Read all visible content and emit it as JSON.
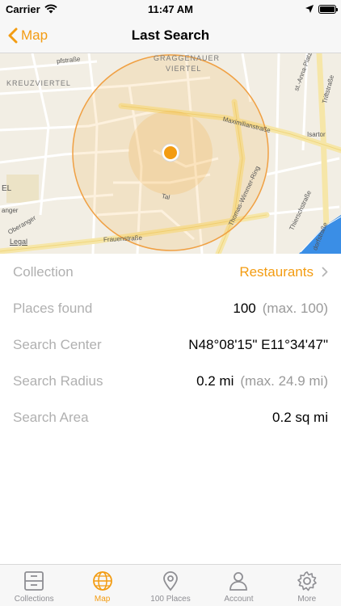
{
  "status_bar": {
    "carrier": "Carrier",
    "time": "11:47 AM"
  },
  "nav": {
    "back_label": "Map",
    "title": "Last Search"
  },
  "map": {
    "district_labels": [
      "GRAGGENAUER",
      "VIERTEL",
      "KREUZVIERTEL"
    ],
    "street_labels": [
      "Maximilianstraße",
      "Thomas-Wimmer-Ring",
      "Frauenstraße",
      "Thierschstraße",
      "Triftstraße",
      "Tal",
      "Oberanger",
      "st.-Anna-Platz",
      "Isartor",
      "dorfstraße",
      "pfstraße",
      "anger",
      "EL"
    ],
    "legal": "Legal"
  },
  "details": {
    "collection": {
      "label": "Collection",
      "value": "Restaurants"
    },
    "places_found": {
      "label": "Places found",
      "value": "100",
      "sub": "(max. 100)"
    },
    "search_center": {
      "label": "Search Center",
      "value": "N48°08'15\" E11°34'47\""
    },
    "search_radius": {
      "label": "Search Radius",
      "value": "0.2 mi",
      "sub": "(max. 24.9 mi)"
    },
    "search_area": {
      "label": "Search Area",
      "value": "0.2 sq mi"
    }
  },
  "tabs": [
    {
      "label": "Collections",
      "icon": "cabinet-icon"
    },
    {
      "label": "Map",
      "icon": "globe-icon"
    },
    {
      "label": "100 Places",
      "icon": "pin-icon"
    },
    {
      "label": "Account",
      "icon": "person-icon"
    },
    {
      "label": "More",
      "icon": "gear-icon"
    }
  ],
  "colors": {
    "accent": "#f39c12",
    "label_gray": "#b0b0b0",
    "map_bg": "#f2eee4",
    "road": "#ffffff",
    "major_road": "#f6e6a8",
    "river": "#3a8ee6"
  }
}
